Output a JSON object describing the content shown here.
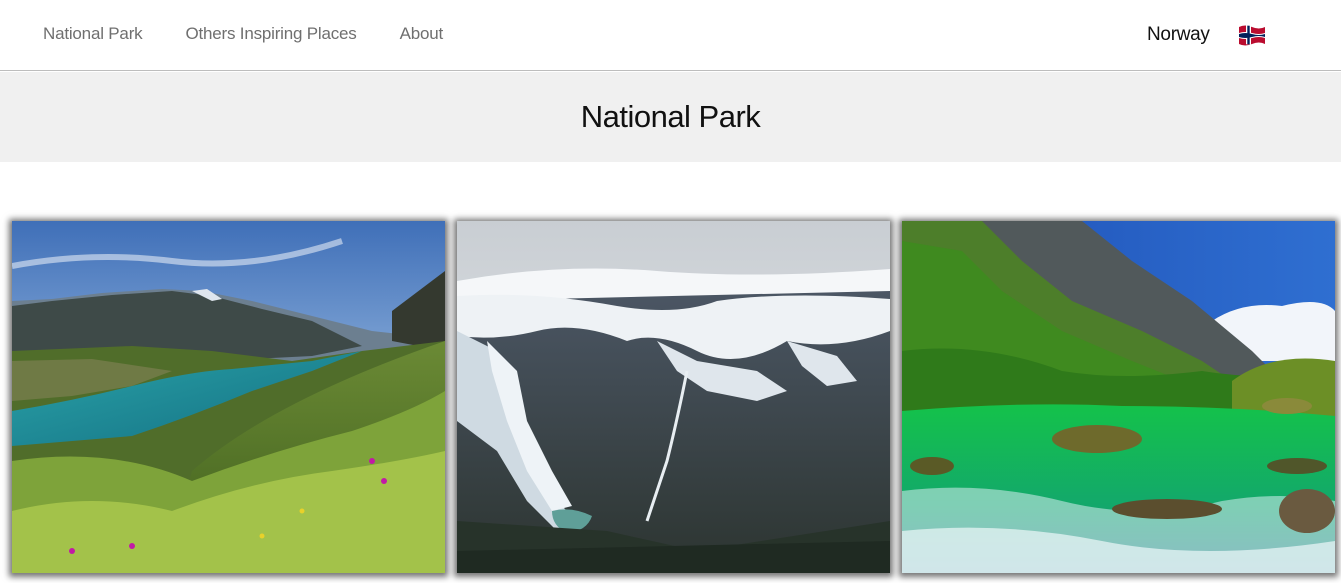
{
  "nav": {
    "links": [
      "National Park",
      "Others Inspiring Places",
      "About"
    ],
    "country": "Norway",
    "flag_icon": "norway-flag-icon"
  },
  "page": {
    "title": "National Park"
  },
  "gallery": {
    "images": [
      {
        "icon": "mountain-lake-photo"
      },
      {
        "icon": "glacier-photo"
      },
      {
        "icon": "green-river-photo"
      }
    ]
  },
  "colors": {
    "nav_text": "#6f6f6f",
    "band_bg": "#f0f0f0",
    "flag_red": "#ba0c2f",
    "flag_blue": "#00205b"
  }
}
